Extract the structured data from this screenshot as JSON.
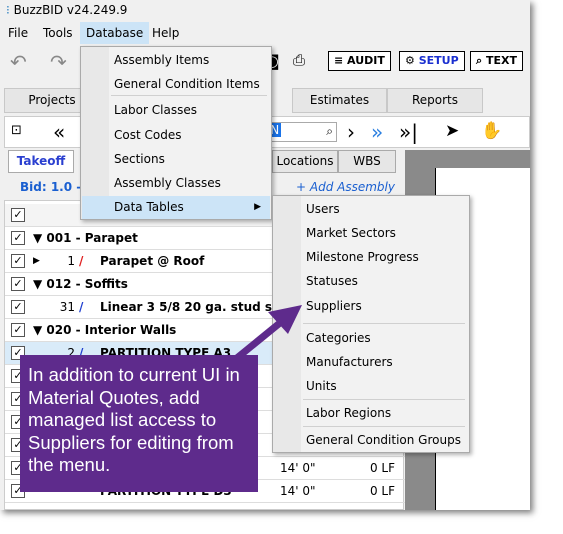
{
  "window": {
    "title": "BuzzBID v24.249.9"
  },
  "menubar": [
    "File",
    "Tools",
    "Database",
    "Help"
  ],
  "toolbar": {
    "audit": "AUDIT",
    "setup": "SETUP",
    "text": "TEXT"
  },
  "tabs": [
    "Projects",
    "Estimates",
    "Reports"
  ],
  "nav": {
    "search_value": "AN"
  },
  "subtabs": [
    "Takeoff",
    "Locations",
    "WBS"
  ],
  "bid_label": "Bid: 1.0 -",
  "add_assembly": "+ Add Assembly",
  "rows": [
    {
      "num": "",
      "name": "▼ 001 - Parapet",
      "group": true
    },
    {
      "num": "1",
      "name": "Parapet @ Roof",
      "color": "#e02020"
    },
    {
      "num": "",
      "name": "▼ 012 - Soffits",
      "group": true
    },
    {
      "num": "31",
      "name": "Linear 3 5/8 20 ga. stud so...",
      "color": "#2040d0"
    },
    {
      "num": "",
      "name": "▼ 020 - Interior Walls",
      "group": true
    },
    {
      "num": "2",
      "name": "PARTITION TYPE A3",
      "color": "#2040d0",
      "selected": true
    },
    {
      "num": "",
      "name": ""
    },
    {
      "num": "",
      "name": ""
    },
    {
      "num": "",
      "name": ""
    },
    {
      "num": "",
      "name": ""
    },
    {
      "num": "",
      "name": "",
      "len": "14' 0\"",
      "qty": "0 LF"
    },
    {
      "num": "",
      "name": "PARTITION TYPE D3",
      "len": "14' 0\"",
      "qty": "0 LF"
    }
  ],
  "database_menu": [
    "Assembly Items",
    "General Condition Items",
    "Labor Classes",
    "Cost Codes",
    "Sections",
    "Assembly Classes",
    "Data Tables"
  ],
  "data_tables_menu": [
    "Users",
    "Market Sectors",
    "Milestone Progress",
    "Statuses",
    "Suppliers",
    "Categories",
    "Manufacturers",
    "Units",
    "Labor Regions",
    "General Condition Groups"
  ],
  "callout": "In addition to current UI in Material Quotes, add managed list access to Suppliers for editing from the menu.",
  "colors": {
    "callout": "#5e2b8c",
    "highlight": "#cce4f7",
    "link": "#1a5fd0"
  }
}
